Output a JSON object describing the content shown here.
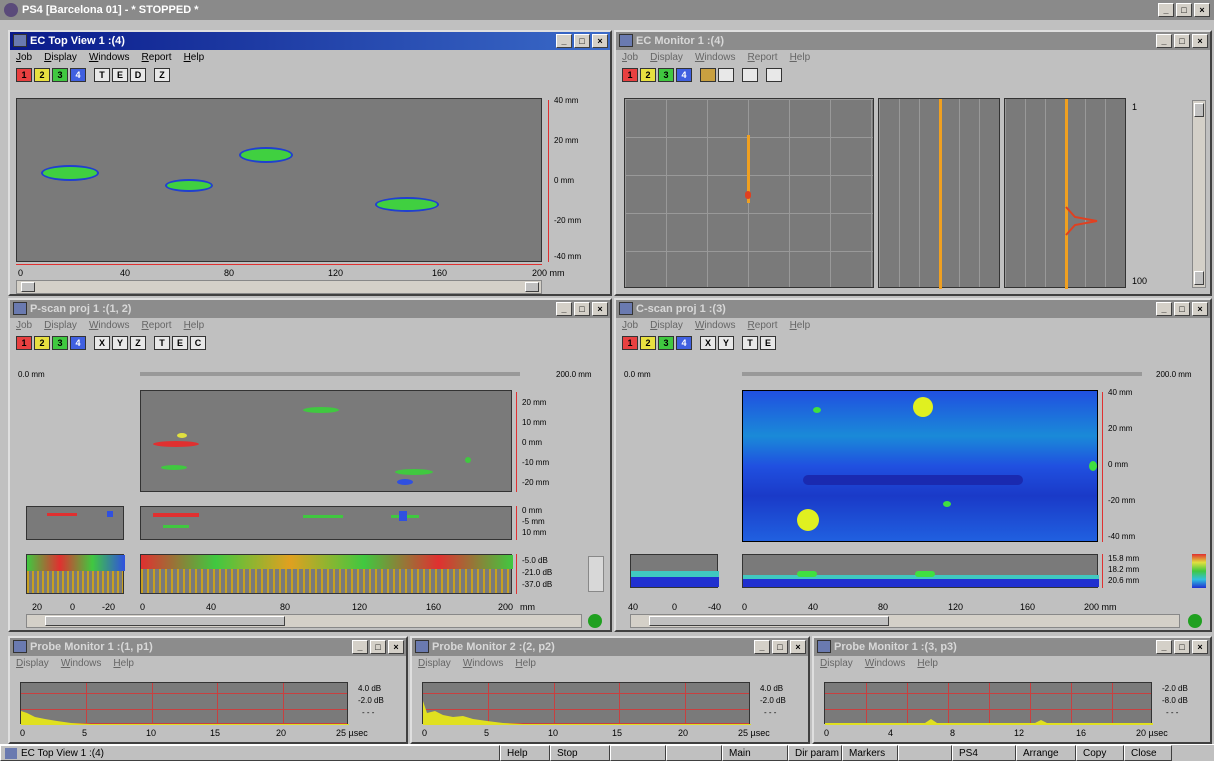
{
  "app": {
    "title": "PS4 [Barcelona 01] - * STOPPED *"
  },
  "win_topview": {
    "title": "EC Top View 1 :(4)",
    "menus": [
      "Job",
      "Display",
      "Windows",
      "Report",
      "Help"
    ],
    "tools": [
      "1",
      "2",
      "3",
      "4",
      "T",
      "E",
      "D",
      "Z"
    ],
    "yscale": [
      "40 mm",
      "20 mm",
      "0 mm",
      "-20 mm",
      "-40 mm"
    ],
    "xscale": [
      "0",
      "40",
      "80",
      "120",
      "160",
      "200 mm"
    ]
  },
  "win_monitor": {
    "title": "EC Monitor 1 :(4)",
    "menus": [
      "Job",
      "Display",
      "Windows",
      "Report",
      "Help"
    ],
    "tools": [
      "1",
      "2",
      "3",
      "4"
    ],
    "scroll_top": "1",
    "scroll_bottom": "100"
  },
  "win_pscan": {
    "title": "P-scan proj 1 :(1, 2)",
    "menus": [
      "Job",
      "Display",
      "Windows",
      "Report",
      "Help"
    ],
    "tools": [
      "1",
      "2",
      "3",
      "4",
      "X",
      "Y",
      "Z",
      "T",
      "E",
      "C"
    ],
    "left_label": "0.0 mm",
    "right_label": "200.0 mm",
    "yscale": [
      "20 mm",
      "10 mm",
      "0 mm",
      "-10 mm",
      "-20 mm"
    ],
    "mid_scale": [
      "0 mm",
      "-5 mm",
      "10 mm"
    ],
    "db_scale": [
      "-5.0 dB",
      "-21.0 dB",
      "-37.0 dB"
    ],
    "xscale_small": [
      "20",
      "0",
      "-20"
    ],
    "xscale": [
      "0",
      "40",
      "80",
      "120",
      "160",
      "200",
      "mm"
    ]
  },
  "win_cscan": {
    "title": "C-scan proj 1 :(3)",
    "menus": [
      "Job",
      "Display",
      "Windows",
      "Report",
      "Help"
    ],
    "tools": [
      "1",
      "2",
      "3",
      "4",
      "X",
      "Y",
      "T",
      "E"
    ],
    "left_label": "0.0 mm",
    "right_label": "200.0 mm",
    "yscale": [
      "40 mm",
      "20 mm",
      "0 mm",
      "-20 mm",
      "-40 mm"
    ],
    "depth_scale": [
      "15.8 mm",
      "18.2 mm",
      "20.6 mm"
    ],
    "xscale_small": [
      "40",
      "0",
      "-40"
    ],
    "xscale": [
      "0",
      "40",
      "80",
      "120",
      "160",
      "200 mm"
    ]
  },
  "probe1": {
    "title": "Probe Monitor 1 :(1, p1)",
    "menus": [
      "Display",
      "Windows",
      "Help"
    ],
    "scale": [
      "4.0 dB",
      "-2.0 dB",
      "- - -"
    ],
    "xscale": [
      "0",
      "5",
      "10",
      "15",
      "20",
      "25 µsec"
    ]
  },
  "probe2": {
    "title": "Probe Monitor 2 :(2, p2)",
    "menus": [
      "Display",
      "Windows",
      "Help"
    ],
    "scale": [
      "4.0 dB",
      "-2.0 dB",
      "- - -"
    ],
    "xscale": [
      "0",
      "5",
      "10",
      "15",
      "20",
      "25 µsec"
    ]
  },
  "probe3": {
    "title": "Probe Monitor 1 :(3, p3)",
    "menus": [
      "Display",
      "Windows",
      "Help"
    ],
    "scale": [
      "-2.0 dB",
      "-8.0 dB",
      "- - -"
    ],
    "xscale": [
      "0",
      "4",
      "8",
      "12",
      "16",
      "20 µsec"
    ]
  },
  "status": {
    "left": "EC Top View 1 :(4)",
    "help": "Help",
    "stop": "Stop",
    "main": "Main",
    "dir_param": "Dir param",
    "markers": "Markers",
    "ps4": "PS4",
    "arrange": "Arrange",
    "copy": "Copy",
    "close": "Close"
  },
  "colors": {
    "plot_bg": "#7a7a7a",
    "accent_red": "#e03030",
    "title_active": "#0a1a8a"
  }
}
